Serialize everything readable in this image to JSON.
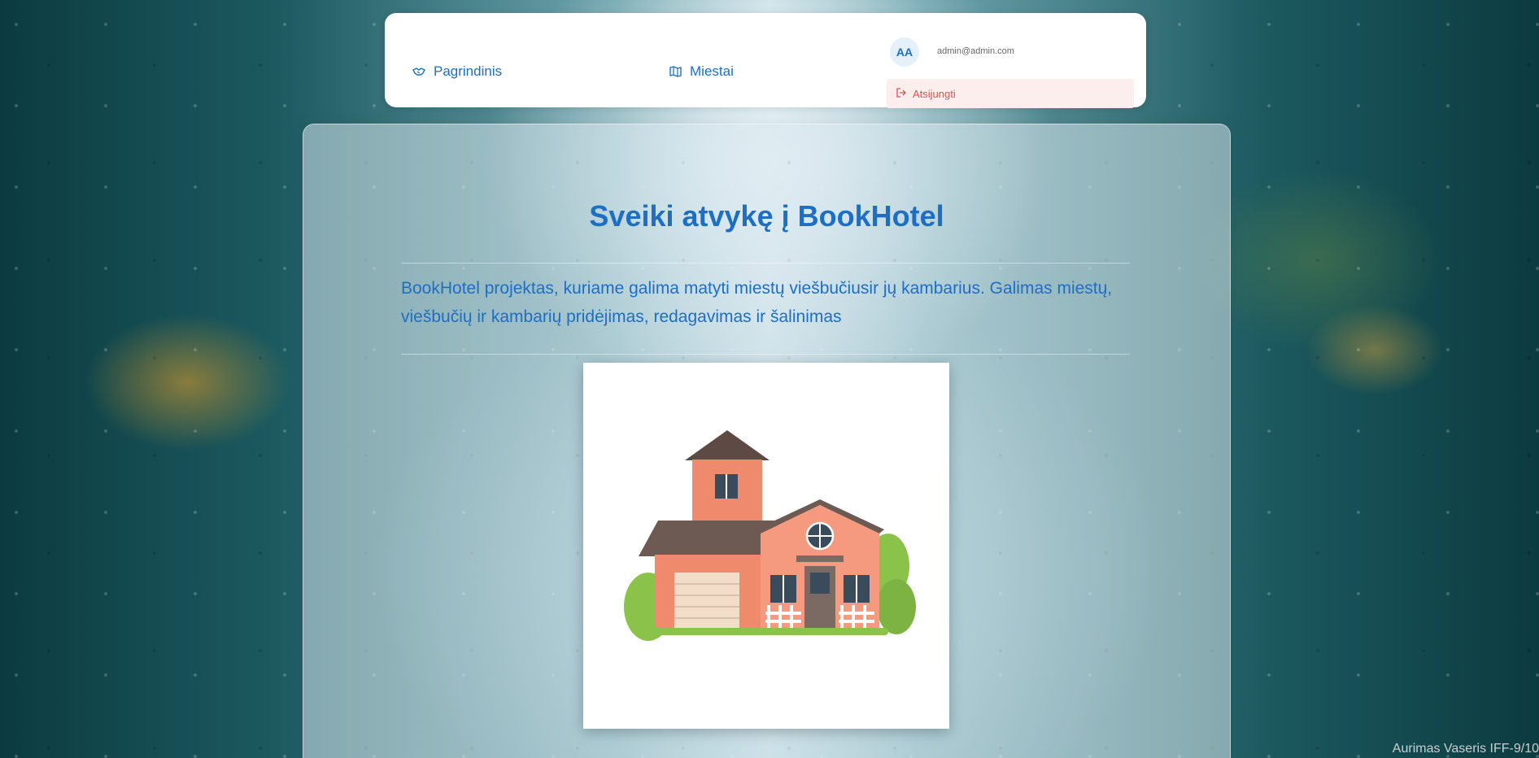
{
  "nav": {
    "items": [
      {
        "label": "Pagrindinis",
        "icon": "handshake-icon"
      },
      {
        "label": "Miestai",
        "icon": "map-icon"
      }
    ]
  },
  "user": {
    "initials": "AA",
    "email": "admin@admin.com",
    "logout_label": "Atsijungti",
    "logout_icon": "logout-icon"
  },
  "main": {
    "title": "Sveiki atvykę į BookHotel",
    "description": "BookHotel projektas, kuriame galima matyti miestų viešbučiusir jų kambarius. Galimas miestų, viešbučių ir kambarių pridėjimas, redagavimas ir šalinimas",
    "image": "house-illustration"
  },
  "footer": {
    "watermark": "Aurimas Vaseris IFF-9/10"
  },
  "colors": {
    "accent": "#1d6fc4",
    "danger": "#d9534f",
    "danger_bg": "#fdeeee"
  }
}
